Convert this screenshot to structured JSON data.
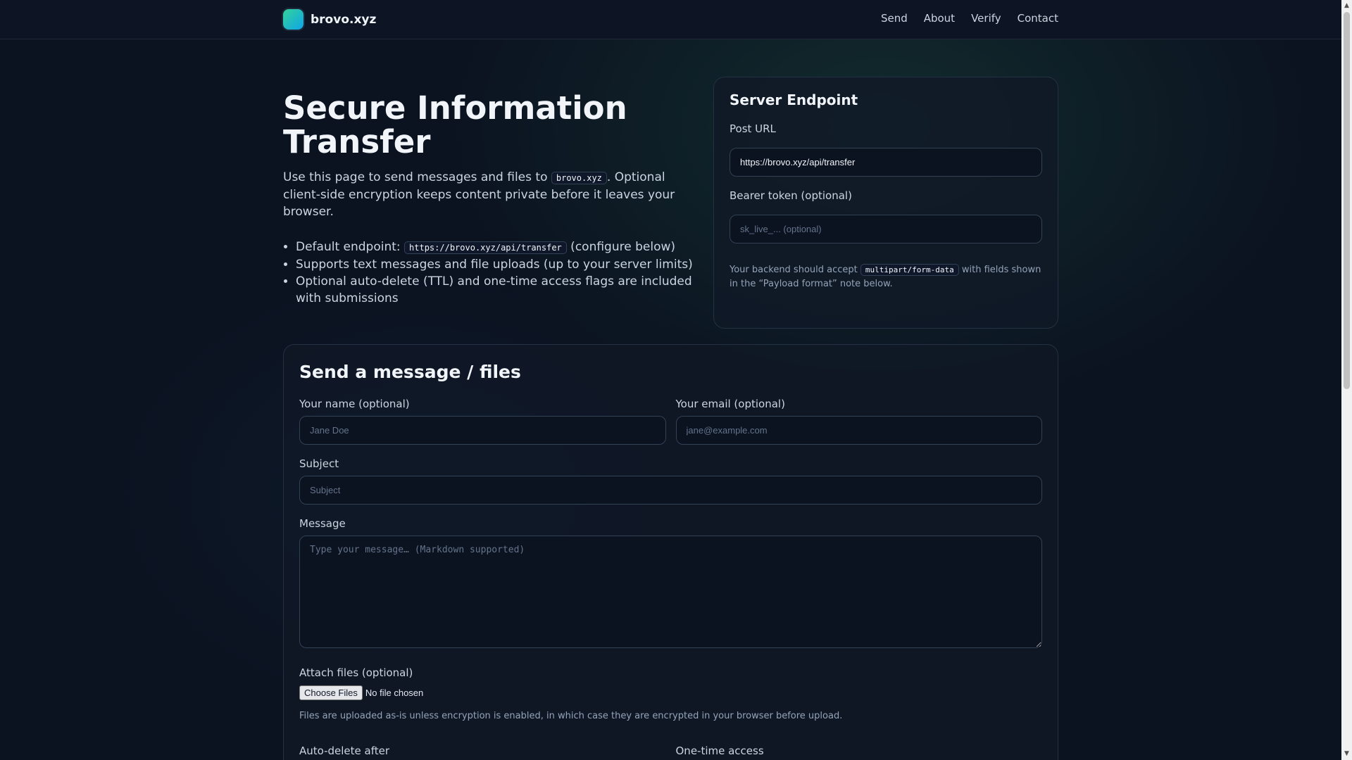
{
  "brand": {
    "name": "brovo.xyz"
  },
  "nav": [
    "Send",
    "About",
    "Verify",
    "Contact"
  ],
  "hero": {
    "title": "Secure Information Transfer",
    "intro_before": "Use this page to send messages and files to ",
    "intro_code": "brovo.xyz",
    "intro_after": ". Optional client-side encryption keeps content private before it leaves your browser.",
    "bullets": {
      "b1_before": "Default endpoint: ",
      "b1_code": "https://brovo.xyz/api/transfer",
      "b1_after": " (configure below)",
      "b2": "Supports text messages and file uploads (up to your server limits)",
      "b3": "Optional auto-delete (TTL) and one-time access flags are included with submissions"
    }
  },
  "endpoint": {
    "title": "Server Endpoint",
    "post_url_label": "Post URL",
    "post_url_value": "https://brovo.xyz/api/transfer",
    "token_label": "Bearer token (optional)",
    "token_placeholder": "sk_live_... (optional)",
    "note_before": "Your backend should accept ",
    "note_code": "multipart/form-data",
    "note_after": " with fields shown in the “Payload format” note below."
  },
  "form": {
    "title": "Send a message / files",
    "name_label": "Your name (optional)",
    "name_placeholder": "Jane Doe",
    "email_label": "Your email (optional)",
    "email_placeholder": "jane@example.com",
    "subject_label": "Subject",
    "subject_placeholder": "Subject",
    "message_label": "Message",
    "message_placeholder": "Type your message… (Markdown supported)",
    "attach_label": "Attach files (optional)",
    "choose_files": "Choose Files",
    "no_file": "No file chosen",
    "files_note": "Files are uploaded as-is unless encryption is enabled, in which case they are encrypted in your browser before upload.",
    "autodelete_label": "Auto-delete after",
    "onetime_label": "One-time access"
  },
  "colors": {
    "background": "#0b1220",
    "card": "#111827",
    "accent": "#34d399"
  }
}
